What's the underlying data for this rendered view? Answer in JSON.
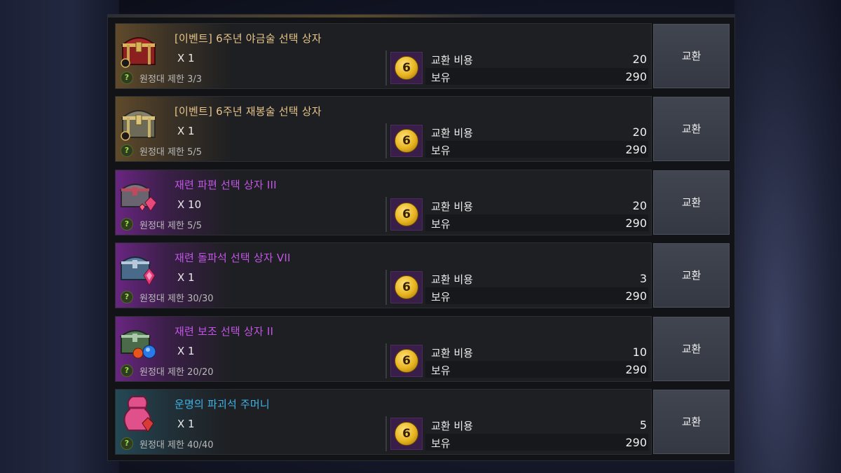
{
  "rows": [
    {
      "name": "[이벤트] 6주년 야금술 선택 상자",
      "name_color": "gold",
      "icon": "red-treasure-chest-icon",
      "qty": "X 1",
      "limit": "원정대 제한 3/3",
      "cost_label": "교환 비용",
      "cost_value": "20",
      "owned_label": "보유",
      "owned_value": "290",
      "button": "교환"
    },
    {
      "name": "[이벤트] 6주년 재봉술 선택 상자",
      "name_color": "gold",
      "icon": "silver-treasure-chest-icon",
      "qty": "X 1",
      "limit": "원정대 제한 5/5",
      "cost_label": "교환 비용",
      "cost_value": "20",
      "owned_label": "보유",
      "owned_value": "290",
      "button": "교환"
    },
    {
      "name": "재련 파편 선택 상자 III",
      "name_color": "purple",
      "icon": "red-gem-chest-icon",
      "qty": "X 10",
      "limit": "원정대 제한 5/5",
      "cost_label": "교환 비용",
      "cost_value": "20",
      "owned_label": "보유",
      "owned_value": "290",
      "button": "교환"
    },
    {
      "name": "재련 돌파석 선택 상자 VII",
      "name_color": "purple",
      "icon": "blue-gem-chest-icon",
      "qty": "X 1",
      "limit": "원정대 제한 30/30",
      "cost_label": "교환 비용",
      "cost_value": "3",
      "owned_label": "보유",
      "owned_value": "290",
      "button": "교환"
    },
    {
      "name": "재련 보조 선택 상자 II",
      "name_color": "purple",
      "icon": "green-gem-chest-icon",
      "qty": "X 1",
      "limit": "원정대 제한 20/20",
      "cost_label": "교환 비용",
      "cost_value": "10",
      "owned_label": "보유",
      "owned_value": "290",
      "button": "교환"
    },
    {
      "name": "운명의 파괴석 주머니",
      "name_color": "blue",
      "icon": "pink-pouch-icon",
      "qty": "X 1",
      "limit": "원정대 제한 40/40",
      "cost_label": "교환 비용",
      "cost_value": "5",
      "owned_label": "보유",
      "owned_value": "290",
      "button": "교환"
    }
  ],
  "currency_icon": "anniversary-6-coin-icon",
  "currency_glyph": "6",
  "limit_glyph": "?"
}
